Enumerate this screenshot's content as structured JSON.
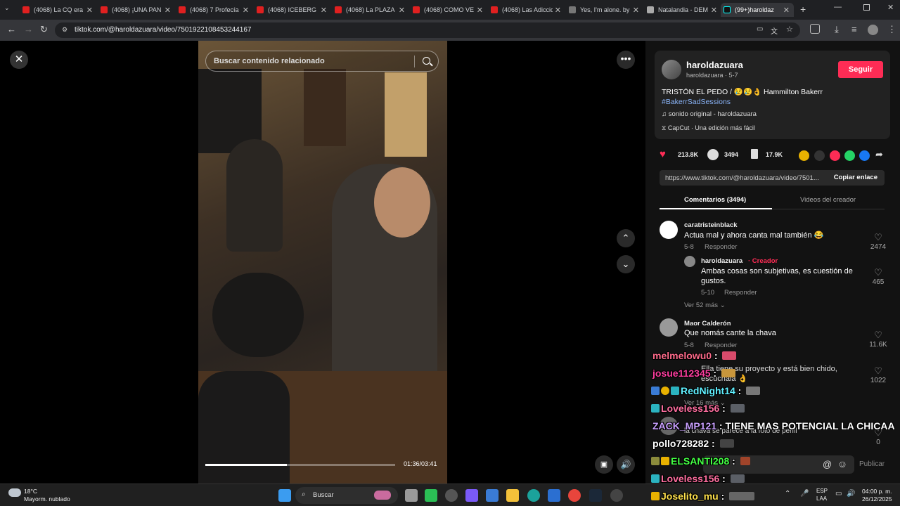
{
  "browser": {
    "tabs": [
      {
        "title": "(4068) La CQ era",
        "icon": "youtube-icon"
      },
      {
        "title": "(4068) ¡UNA PAN",
        "icon": "youtube-icon"
      },
      {
        "title": "(4068) 7 Profecía",
        "icon": "youtube-icon"
      },
      {
        "title": "(4068) ICEBERG D",
        "icon": "youtube-icon"
      },
      {
        "title": "(4068) La PLAZA",
        "icon": "youtube-icon"
      },
      {
        "title": "(4068) COMO VE",
        "icon": "youtube-icon"
      },
      {
        "title": "(4068) Las Adiccio",
        "icon": "youtube-icon"
      },
      {
        "title": "Yes, I'm alone. by",
        "icon": "page-icon"
      },
      {
        "title": "Natalandia - DEM",
        "icon": "page-icon"
      },
      {
        "title": "(99+)haroldaz",
        "icon": "tiktok-icon"
      }
    ],
    "url": "tiktok.com/@haroldazuara/video/7501922108453244167"
  },
  "video": {
    "search_placeholder": "Buscar contenido relacionado",
    "time": "01:36/03:41",
    "progress": 0.43
  },
  "author": {
    "name": "haroldazuara",
    "sub": "haroldazuara · 5-7",
    "follow": "Seguir",
    "description": "TRISTÓN EL PEDO / 😢😢👌 Hammilton Bakerr",
    "hashtag": "#BakerrSadSessions",
    "music": "sonido original - haroldazuara",
    "capcut": "CapCut · Una edición más fácil"
  },
  "stats": {
    "likes": "213.8K",
    "comments": "3494",
    "saves": "17.9K"
  },
  "link": {
    "url": "https://www.tiktok.com/@haroldazuara/video/7501...",
    "copy": "Copiar enlace"
  },
  "tabs": {
    "comments": "Comentarios (3494)",
    "creator_videos": "Videos del creador"
  },
  "comments": [
    {
      "user": "caratristeinblack",
      "text": "Actua mal y ahora canta mal también 😂",
      "date": "5-8",
      "reply": "Responder",
      "likes": "2474"
    },
    {
      "user": "haroldazuara",
      "creator_tag": "· Creador",
      "text1": "Ambas cosas son subjetivas, es cuestión de",
      "text2": "gustos.",
      "date": "5-10",
      "reply": "Responder",
      "likes": "465"
    },
    {
      "more": "Ver 52 más"
    },
    {
      "user": "Maor Calderón",
      "text": "Que nomás cante la chava",
      "date": "5-8",
      "reply": "Responder",
      "likes": "11.6K"
    },
    {
      "text1": "Ella tiene su proyecto y está bien chido,",
      "text2": "escúchala 👌",
      "likes": "1022"
    },
    {
      "more": "Ver 16 más"
    },
    {
      "text": "la chava se parece a la foto de perfil",
      "likes": "0"
    }
  ],
  "chat": [
    {
      "user": "melmelowu0",
      "msg": "",
      "color": "#ff6b8b"
    },
    {
      "user": "josue112345",
      "msg": "",
      "color": "#ff3fa0"
    },
    {
      "user": "RedNight14",
      "msg": "",
      "color": "#60f0ff"
    },
    {
      "user": "Loveless156",
      "msg": "",
      "color": "#ff6fa0"
    },
    {
      "user": "ZACK_MP121",
      "msg": "TIENE MAS POTENCIAL LA CHICAA",
      "color": "#c9a0ff"
    },
    {
      "user": "pollo728282",
      "msg": "",
      "color": "#ffffff"
    },
    {
      "user": "ELSANTI208",
      "msg": "",
      "color": "#44ff44"
    },
    {
      "user": "Loveless156",
      "msg": "",
      "color": "#ff6fa0"
    },
    {
      "user": "Joselito_mu",
      "msg": "",
      "color": "#ffe14d"
    }
  ],
  "comment_box": {
    "publish": "Publicar"
  },
  "taskbar": {
    "weather_temp": "18°C",
    "weather_desc": "Mayorm. nublado",
    "search": "Buscar",
    "lang1": "ESP",
    "lang2": "LAA",
    "time": "04:00 p. m.",
    "date": "26/12/2025"
  }
}
